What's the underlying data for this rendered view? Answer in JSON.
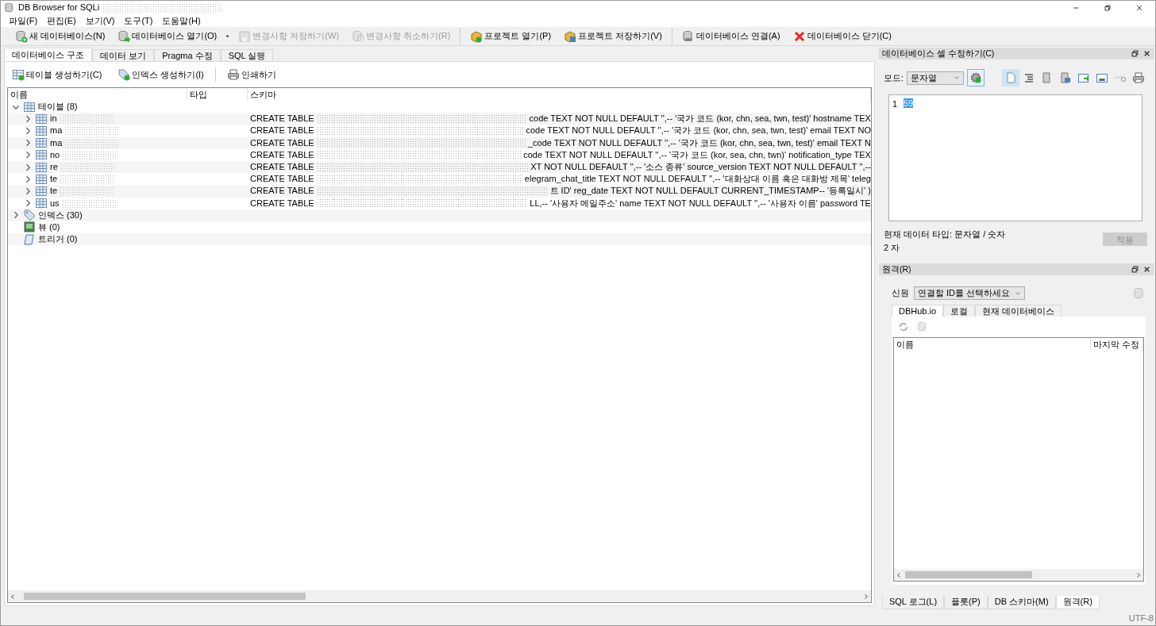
{
  "window": {
    "title": "DB Browser for SQLi"
  },
  "menu": [
    "파일(F)",
    "편집(E)",
    "보기(V)",
    "도구(T)",
    "도움말(H)"
  ],
  "toolbar_groups": [
    [
      {
        "label": "새 데이터베이스(N)",
        "kind": "new-db",
        "disabled": false,
        "dropdown": false
      },
      {
        "label": "데이터베이스 열기(O)",
        "kind": "open-db",
        "disabled": false,
        "dropdown": true
      },
      {
        "label": "변경사항 저장하기(W)",
        "kind": "save",
        "disabled": true,
        "dropdown": false
      },
      {
        "label": "변경사항 취소하기(R)",
        "kind": "revert",
        "disabled": true,
        "dropdown": false
      }
    ],
    [
      {
        "label": "프로젝트 열기(P)",
        "kind": "open-project",
        "disabled": false,
        "dropdown": false
      },
      {
        "label": "프로젝트 저장하기(V)",
        "kind": "save-project",
        "disabled": false,
        "dropdown": false
      }
    ],
    [
      {
        "label": "데이터베이스 연결(A)",
        "kind": "attach",
        "disabled": false,
        "dropdown": false
      },
      {
        "label": "데이터베이스 닫기(C)",
        "kind": "close",
        "disabled": false,
        "dropdown": false
      }
    ]
  ],
  "tabs": [
    {
      "label": "데이터베이스 구조",
      "selected": true
    },
    {
      "label": "데이터 보기",
      "selected": false
    },
    {
      "label": "Pragma 수정",
      "selected": false
    },
    {
      "label": "SQL 실행",
      "selected": false
    }
  ],
  "structure_toolbar": [
    {
      "label": "테이블 생성하기(C)",
      "kind": "create-table"
    },
    {
      "label": "인덱스 생성하기(I)",
      "kind": "create-index"
    },
    {
      "label": "인쇄하기",
      "kind": "print"
    }
  ],
  "tree": {
    "columns": [
      "이름",
      "타입",
      "스키마"
    ],
    "nodes": [
      {
        "label": "테이블 (8)",
        "kind": "tables",
        "expanded": true,
        "children": [
          {
            "label": "in",
            "kind": "table",
            "expanded": false,
            "schema_start": "CREATE TABLE",
            "schema_end": "code TEXT NOT NULL DEFAULT '',-- '국가 코드 (kor, chn, sea, twn, test)' hostname TEX"
          },
          {
            "label": "ma",
            "kind": "table",
            "expanded": false,
            "schema_start": "CREATE TABLE",
            "schema_end": "code TEXT NOT NULL DEFAULT '',-- '국가 코드 (kor, chn, sea, twn, test)' email TEXT NO"
          },
          {
            "label": "ma",
            "kind": "table",
            "expanded": false,
            "schema_start": "CREATE TABLE",
            "schema_end": "_code TEXT NOT NULL DEFAULT '',-- '국가 코드 (kor, chn, sea, twn, test)' email TEXT N"
          },
          {
            "label": "no",
            "kind": "table",
            "expanded": false,
            "schema_start": "CREATE TABLE",
            "schema_end": "code TEXT NOT NULL DEFAULT '',-- '국가 코드 (kor, sea, chn, twn)' notification_type TEX"
          },
          {
            "label": "re",
            "kind": "table",
            "expanded": false,
            "schema_start": "CREATE TABLE",
            "schema_end": "XT NOT NULL DEFAULT '',-- '소스 종류' source_version TEXT NOT NULL DEFAULT '',--"
          },
          {
            "label": "te",
            "kind": "table",
            "expanded": false,
            "schema_start": "CREATE TABLE",
            "schema_end": "elegram_chat_title TEXT NOT NULL DEFAULT '',-- '대화상대 이름 혹은 대화방 제목' teleg"
          },
          {
            "label": "te",
            "kind": "table",
            "expanded": false,
            "schema_start": "CREATE TABLE",
            "schema_end": "트 ID' reg_date TEXT NOT NULL DEFAULT CURRENT_TIMESTAMP-- '등록일시' )"
          },
          {
            "label": "us",
            "kind": "table",
            "expanded": false,
            "schema_start": "CREATE TABLE",
            "schema_end": "LL,-- '사용자 메일주소' name TEXT NOT NULL DEFAULT '',-- '사용자 이름' password TE"
          }
        ]
      },
      {
        "label": "인덱스 (30)",
        "kind": "indexes",
        "expanded": false
      },
      {
        "label": "뷰 (0)",
        "kind": "views"
      },
      {
        "label": "트리거 (0)",
        "kind": "triggers"
      }
    ]
  },
  "cell_editor": {
    "title": "데이터베이스 셀 수정하기(C)",
    "mode_label": "모드:",
    "mode": "문자열",
    "tools": [
      {
        "kind": "text",
        "selected": true
      },
      {
        "kind": "indent",
        "selected": false
      },
      {
        "kind": "import",
        "selected": false
      },
      {
        "kind": "export",
        "selected": false
      },
      {
        "kind": "set-null",
        "selected": false
      },
      {
        "kind": "link",
        "selected": false
      },
      {
        "kind": "toggle",
        "selected": false
      },
      {
        "kind": "print",
        "selected": false
      }
    ],
    "line_number": "1",
    "value": "59",
    "type_info": "현재 데이터 타입: 문자열 / 숫자",
    "size_info": "2 자",
    "apply": {
      "label": "적용",
      "disabled": true
    }
  },
  "remote": {
    "title": "원격(R)",
    "identity_label": "신원",
    "identity": "연결할 ID를 선택하세요",
    "tabs": [
      {
        "label": "DBHub.io",
        "selected": true
      },
      {
        "label": "로컬",
        "selected": false
      },
      {
        "label": "현재 데이터베이스",
        "selected": false
      }
    ],
    "columns": [
      "이름",
      "마지막 수정"
    ]
  },
  "bottom_tabs": [
    {
      "label": "SQL 로그(L)",
      "selected": false
    },
    {
      "label": "플롯(P)",
      "selected": false
    },
    {
      "label": "DB 스키마(M)",
      "selected": false
    },
    {
      "label": "원격(R)",
      "selected": true
    }
  ],
  "status_bar": {
    "encoding": "UTF-8"
  }
}
